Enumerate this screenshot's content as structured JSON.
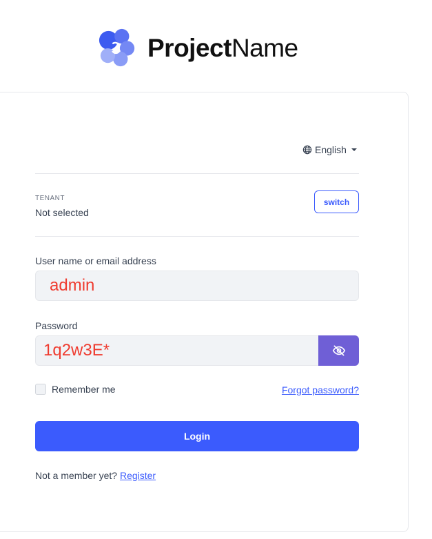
{
  "brand": {
    "name_bold": "Project",
    "name_light": "Name",
    "logo_icon": "project-logo-icon"
  },
  "language": {
    "selected": "English",
    "icon": "globe-icon"
  },
  "tenant": {
    "label": "TENANT",
    "value": "Not selected",
    "switch_label": "switch"
  },
  "username": {
    "label": "User name or email address",
    "value": "admin"
  },
  "password": {
    "label": "Password",
    "value": "1q2w3E*",
    "toggle_icon": "eye-slash-icon"
  },
  "remember": {
    "label": "Remember me",
    "checked": false
  },
  "forgot": {
    "label": "Forgot password?"
  },
  "login": {
    "label": "Login"
  },
  "register": {
    "prompt": "Not a member yet?",
    "link": "Register"
  },
  "colors": {
    "primary": "#3b5bfd",
    "toggle": "#6f5fd6",
    "input_bg": "#f1f3f6",
    "value_text": "#ef3b2f"
  }
}
